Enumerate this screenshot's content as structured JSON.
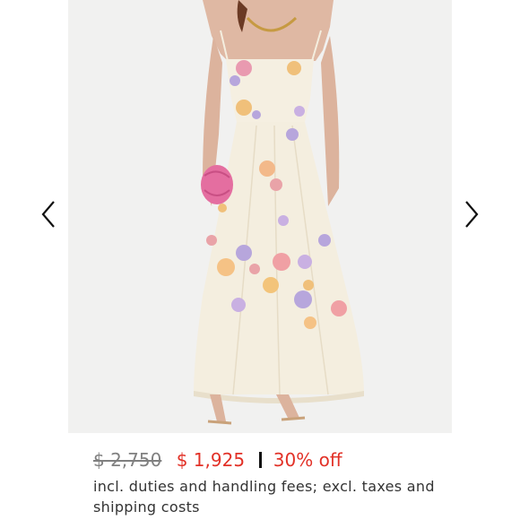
{
  "listing": {
    "image_alt": "Cream floral-appliqué sleeveless maxi dress",
    "nav": {
      "prev_icon": "chevron-left-icon",
      "next_icon": "chevron-right-icon"
    },
    "price": {
      "original": "$ 2,750",
      "sale": "$ 1,925",
      "discount": "30% off"
    },
    "note": "incl. duties and handling fees; excl. taxes and shipping costs"
  },
  "colors": {
    "sale_red": "#e23127",
    "strike_gray": "#808080",
    "photo_bg": "#f1f1f0",
    "dress_cream": "#f4eedf"
  }
}
